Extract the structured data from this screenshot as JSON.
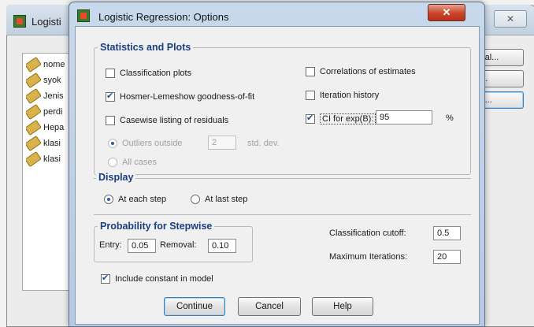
{
  "background_window": {
    "title": "Logisti",
    "close_glyph": "✕",
    "variables": [
      "nome",
      "syok",
      "Jenis",
      "perdi",
      "Hepa",
      "klasi",
      "klasi"
    ],
    "buttons": [
      "rical...",
      "e...",
      "ns..."
    ]
  },
  "dialog": {
    "title": "Logistic Regression: Options",
    "close_glyph": "✕"
  },
  "statistics_and_plots": {
    "legend": "Statistics and Plots",
    "classification_plots": {
      "label": "Classification plots",
      "checked": false
    },
    "hosmer_lemeshow": {
      "label": "Hosmer-Lemeshow goodness-of-fit",
      "checked": true
    },
    "casewise_listing": {
      "label": "Casewise listing of residuals",
      "checked": false
    },
    "outliers_outside": {
      "label": "Outliers outside",
      "value": "2",
      "unit": "std. dev.",
      "enabled": false
    },
    "all_cases": {
      "label": "All cases",
      "enabled": false
    },
    "correlations": {
      "label": "Correlations of estimates",
      "checked": false
    },
    "iteration_history": {
      "label": "Iteration history",
      "checked": false
    },
    "ci_for_exp": {
      "label": "CI for exp(B):",
      "checked": true,
      "value": "95",
      "unit": "%"
    }
  },
  "display": {
    "legend": "Display",
    "at_each_step": {
      "label": "At each step",
      "selected": true
    },
    "at_last_step": {
      "label": "At last step",
      "selected": false
    }
  },
  "probability_for_stepwise": {
    "legend": "Probability for Stepwise",
    "entry_label": "Entry:",
    "entry_value": "0.05",
    "removal_label": "Removal:",
    "removal_value": "0.10"
  },
  "classification_cutoff": {
    "label": "Classification cutoff:",
    "value": "0.5"
  },
  "maximum_iterations": {
    "label": "Maximum Iterations:",
    "value": "20"
  },
  "include_constant": {
    "label": "Include constant in model",
    "checked": true
  },
  "buttons": {
    "continue": "Continue",
    "cancel": "Cancel",
    "help": "Help"
  }
}
